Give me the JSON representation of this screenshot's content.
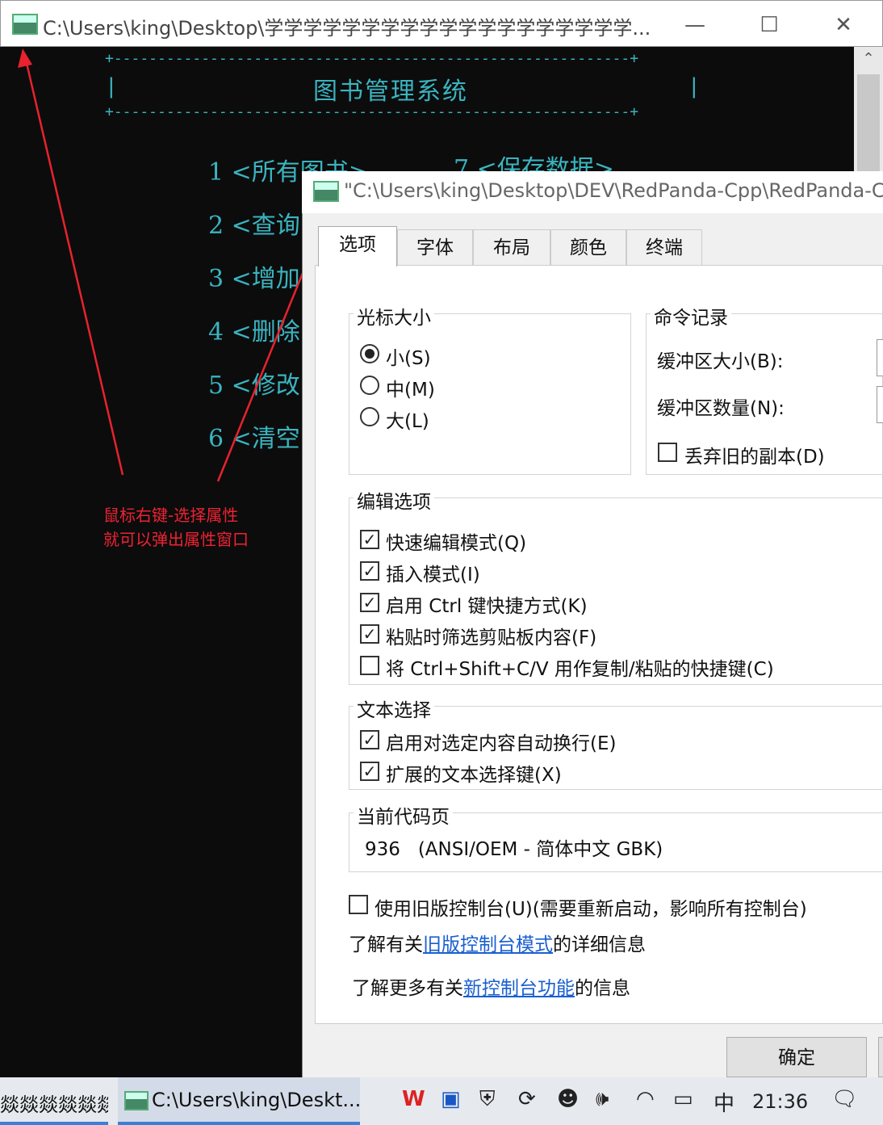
{
  "console": {
    "window_title": "C:\\Users\\king\\Desktop\\学学学学学学学学学学学学学学学学学学学...",
    "border_line": "+-----------------------------------------------------------+",
    "side_bar": "|",
    "system_title": "图书管理系统",
    "menu": {
      "item1": "1 <所有图书>",
      "item7": "7 <保存数据>",
      "item2": "2 <查询",
      "item3": "3 <增加",
      "item4": "4 <删除",
      "item5": "5 <修改",
      "item6": "6 <清空"
    },
    "buttons": {
      "minimize": "—",
      "maximize": "☐",
      "close": "✕"
    }
  },
  "annotation": {
    "line1": "鼠标右键-选择属性",
    "line2": "就可以弹出属性窗口",
    "color": "#e8222e"
  },
  "dialog": {
    "title": "\"C:\\Users\\king\\Desktop\\DEV\\RedPanda-Cpp\\RedPanda-Cpp",
    "tabs": [
      "选项",
      "字体",
      "布局",
      "颜色",
      "终端"
    ],
    "active_tab": "选项",
    "cursor_size": {
      "legend": "光标大小",
      "options": [
        "小(S)",
        "中(M)",
        "大(L)"
      ],
      "selected": "小(S)"
    },
    "command_history": {
      "legend": "命令记录",
      "buffer_size_label": "缓冲区大小(B):",
      "buffer_count_label": "缓冲区数量(N):",
      "discard_old_label": "丢弃旧的副本(D)",
      "discard_old_checked": false
    },
    "edit_options": {
      "legend": "编辑选项",
      "quick_edit": "快速编辑模式(Q)",
      "insert_mode": "插入模式(I)",
      "ctrl_keys": "启用 Ctrl 键快捷方式(K)",
      "filter_paste": "粘贴时筛选剪贴板内容(F)",
      "ctrl_shift_cv": "将 Ctrl+Shift+C/V 用作复制/粘贴的快捷键(C)",
      "states": [
        true,
        true,
        true,
        true,
        false
      ]
    },
    "text_selection": {
      "legend": "文本选择",
      "line_wrap": "启用对选定内容自动换行(E)",
      "extended_keys": "扩展的文本选择键(X)",
      "states": [
        true,
        true
      ]
    },
    "codepage": {
      "legend": "当前代码页",
      "value": "936   (ANSI/OEM - 简体中文 GBK)"
    },
    "legacy_console": {
      "label": "使用旧版控制台(U)(需要重新启动，影响所有控制台)",
      "checked": false,
      "learn_prefix": "了解有关",
      "learn_link": "旧版控制台模式",
      "learn_suffix": "的详细信息"
    },
    "new_features": {
      "prefix": "了解更多有关",
      "link": "新控制台功能",
      "suffix": "的信息"
    },
    "ok_button": "确定"
  },
  "taskbar": {
    "left_fragment": "燚燚燚燚燚燚燚燚",
    "active_window": "C:\\Users\\king\\Deskt...",
    "input_method": "中",
    "time": "21:36"
  }
}
